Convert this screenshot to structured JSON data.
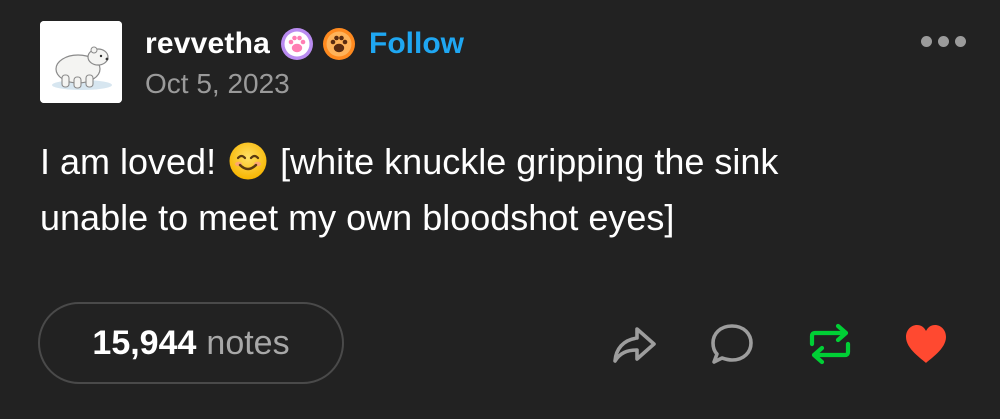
{
  "post": {
    "username": "revvetha",
    "follow_label": "Follow",
    "date": "Oct 5, 2023",
    "body_line1": "I am loved!",
    "body_emoji": "smiling-face-with-smiling-eyes",
    "body_line1_rest": "[white knuckle gripping the sink",
    "body_line2": "unable to meet my own bloodshot eyes]"
  },
  "footer": {
    "notes_count": "15,944",
    "notes_label": "notes"
  },
  "icons": {
    "avatar": "polar-bear",
    "badges": [
      "pink-paw-badge",
      "orange-paw-badge"
    ],
    "more": "more-horizontal-icon",
    "actions": [
      "share-icon",
      "reply-icon",
      "reblog-icon",
      "like-icon"
    ]
  },
  "colors": {
    "background": "#222222",
    "follow": "#1fa7f2",
    "reblog_active": "#00cf35",
    "like_active": "#ff4930",
    "muted_text": "#9a9a9a"
  }
}
